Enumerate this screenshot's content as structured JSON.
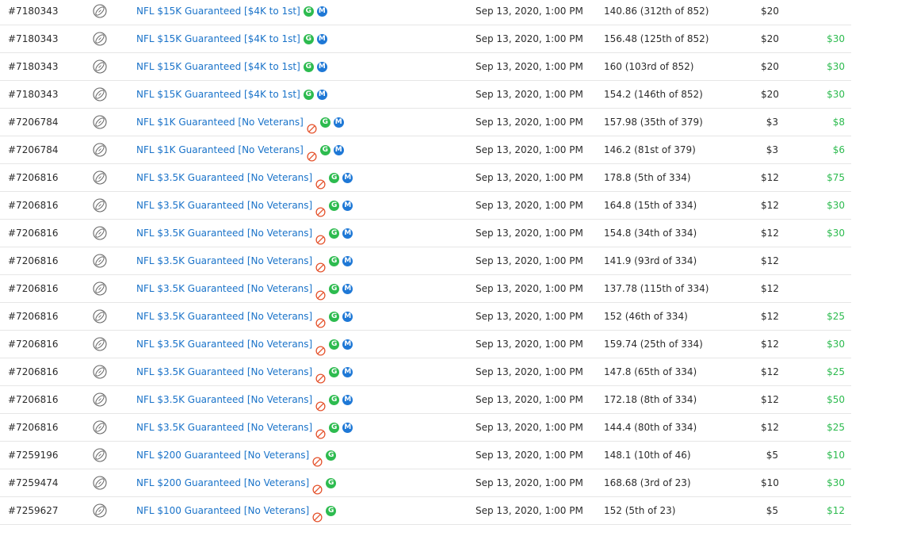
{
  "rows": [
    {
      "id": "#7180343",
      "contest": "NFL $15K Guaranteed [$4K to 1st]",
      "no_veterans": false,
      "m_badge": true,
      "date": "Sep 13, 2020, 1:00 PM",
      "score": "140.86 (312th of 852)",
      "entry": "$20",
      "winnings": ""
    },
    {
      "id": "#7180343",
      "contest": "NFL $15K Guaranteed [$4K to 1st]",
      "no_veterans": false,
      "m_badge": true,
      "date": "Sep 13, 2020, 1:00 PM",
      "score": "156.48 (125th of 852)",
      "entry": "$20",
      "winnings": "$30"
    },
    {
      "id": "#7180343",
      "contest": "NFL $15K Guaranteed [$4K to 1st]",
      "no_veterans": false,
      "m_badge": true,
      "date": "Sep 13, 2020, 1:00 PM",
      "score": "160 (103rd of 852)",
      "entry": "$20",
      "winnings": "$30"
    },
    {
      "id": "#7180343",
      "contest": "NFL $15K Guaranteed [$4K to 1st]",
      "no_veterans": false,
      "m_badge": true,
      "date": "Sep 13, 2020, 1:00 PM",
      "score": "154.2 (146th of 852)",
      "entry": "$20",
      "winnings": "$30"
    },
    {
      "id": "#7206784",
      "contest": "NFL $1K Guaranteed [No Veterans]",
      "no_veterans": true,
      "m_badge": true,
      "date": "Sep 13, 2020, 1:00 PM",
      "score": "157.98 (35th of 379)",
      "entry": "$3",
      "winnings": "$8"
    },
    {
      "id": "#7206784",
      "contest": "NFL $1K Guaranteed [No Veterans]",
      "no_veterans": true,
      "m_badge": true,
      "date": "Sep 13, 2020, 1:00 PM",
      "score": "146.2 (81st of 379)",
      "entry": "$3",
      "winnings": "$6"
    },
    {
      "id": "#7206816",
      "contest": "NFL $3.5K Guaranteed [No Veterans]",
      "no_veterans": true,
      "m_badge": true,
      "date": "Sep 13, 2020, 1:00 PM",
      "score": "178.8 (5th of 334)",
      "entry": "$12",
      "winnings": "$75"
    },
    {
      "id": "#7206816",
      "contest": "NFL $3.5K Guaranteed [No Veterans]",
      "no_veterans": true,
      "m_badge": true,
      "date": "Sep 13, 2020, 1:00 PM",
      "score": "164.8 (15th of 334)",
      "entry": "$12",
      "winnings": "$30"
    },
    {
      "id": "#7206816",
      "contest": "NFL $3.5K Guaranteed [No Veterans]",
      "no_veterans": true,
      "m_badge": true,
      "date": "Sep 13, 2020, 1:00 PM",
      "score": "154.8 (34th of 334)",
      "entry": "$12",
      "winnings": "$30"
    },
    {
      "id": "#7206816",
      "contest": "NFL $3.5K Guaranteed [No Veterans]",
      "no_veterans": true,
      "m_badge": true,
      "date": "Sep 13, 2020, 1:00 PM",
      "score": "141.9 (93rd of 334)",
      "entry": "$12",
      "winnings": ""
    },
    {
      "id": "#7206816",
      "contest": "NFL $3.5K Guaranteed [No Veterans]",
      "no_veterans": true,
      "m_badge": true,
      "date": "Sep 13, 2020, 1:00 PM",
      "score": "137.78 (115th of 334)",
      "entry": "$12",
      "winnings": ""
    },
    {
      "id": "#7206816",
      "contest": "NFL $3.5K Guaranteed [No Veterans]",
      "no_veterans": true,
      "m_badge": true,
      "date": "Sep 13, 2020, 1:00 PM",
      "score": "152 (46th of 334)",
      "entry": "$12",
      "winnings": "$25"
    },
    {
      "id": "#7206816",
      "contest": "NFL $3.5K Guaranteed [No Veterans]",
      "no_veterans": true,
      "m_badge": true,
      "date": "Sep 13, 2020, 1:00 PM",
      "score": "159.74 (25th of 334)",
      "entry": "$12",
      "winnings": "$30"
    },
    {
      "id": "#7206816",
      "contest": "NFL $3.5K Guaranteed [No Veterans]",
      "no_veterans": true,
      "m_badge": true,
      "date": "Sep 13, 2020, 1:00 PM",
      "score": "147.8 (65th of 334)",
      "entry": "$12",
      "winnings": "$25"
    },
    {
      "id": "#7206816",
      "contest": "NFL $3.5K Guaranteed [No Veterans]",
      "no_veterans": true,
      "m_badge": true,
      "date": "Sep 13, 2020, 1:00 PM",
      "score": "172.18 (8th of 334)",
      "entry": "$12",
      "winnings": "$50"
    },
    {
      "id": "#7206816",
      "contest": "NFL $3.5K Guaranteed [No Veterans]",
      "no_veterans": true,
      "m_badge": true,
      "date": "Sep 13, 2020, 1:00 PM",
      "score": "144.4 (80th of 334)",
      "entry": "$12",
      "winnings": "$25"
    },
    {
      "id": "#7259196",
      "contest": "NFL $200 Guaranteed [No Veterans]",
      "no_veterans": true,
      "m_badge": false,
      "date": "Sep 13, 2020, 1:00 PM",
      "score": "148.1 (10th of 46)",
      "entry": "$5",
      "winnings": "$10"
    },
    {
      "id": "#7259474",
      "contest": "NFL $200 Guaranteed [No Veterans]",
      "no_veterans": true,
      "m_badge": false,
      "date": "Sep 13, 2020, 1:00 PM",
      "score": "168.68 (3rd of 23)",
      "entry": "$10",
      "winnings": "$30"
    },
    {
      "id": "#7259627",
      "contest": "NFL $100 Guaranteed [No Veterans]",
      "no_veterans": true,
      "m_badge": false,
      "date": "Sep 13, 2020, 1:00 PM",
      "score": "152 (5th of 23)",
      "entry": "$5",
      "winnings": "$12"
    }
  ],
  "badges": {
    "g_label": "G",
    "m_label": "M"
  },
  "icons": {
    "sport": "football-icon",
    "restriction": "no-veterans-icon"
  },
  "colors": {
    "link": "#1a73c9",
    "winnings": "#2dbb4f",
    "g_badge": "#2dbb4f",
    "m_badge": "#1e78d6",
    "restriction": "#e5532d"
  }
}
